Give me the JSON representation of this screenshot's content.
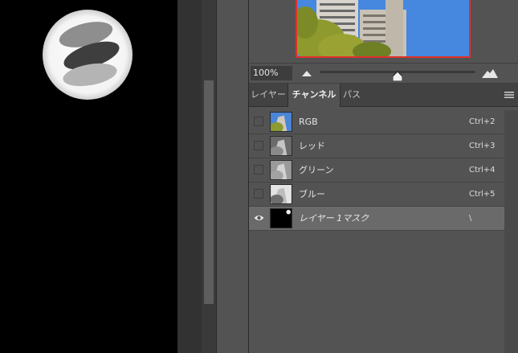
{
  "colors": {
    "canvas_bg": "#000000",
    "panel_bg": "#535353",
    "tab_bar_bg": "#424242",
    "selected_row_bg": "#6a6a6a",
    "nav_frame": "#e0302a"
  },
  "navigator": {
    "zoom_value": "100%",
    "icons": [
      "mountain-small-icon",
      "mountain-large-icon"
    ]
  },
  "tabs": [
    {
      "label": "レイヤー",
      "active": false
    },
    {
      "label": "チャンネル",
      "active": true
    },
    {
      "label": "パス",
      "active": false
    }
  ],
  "channels": [
    {
      "label": "RGB",
      "shortcut": "Ctrl+2",
      "visible": false
    },
    {
      "label": "レッド",
      "shortcut": "Ctrl+3",
      "visible": false
    },
    {
      "label": "グリーン",
      "shortcut": "Ctrl+4",
      "visible": false
    },
    {
      "label": "ブルー",
      "shortcut": "Ctrl+5",
      "visible": false
    },
    {
      "label": "レイヤー 1マスク",
      "shortcut": "\\",
      "visible": true
    }
  ]
}
